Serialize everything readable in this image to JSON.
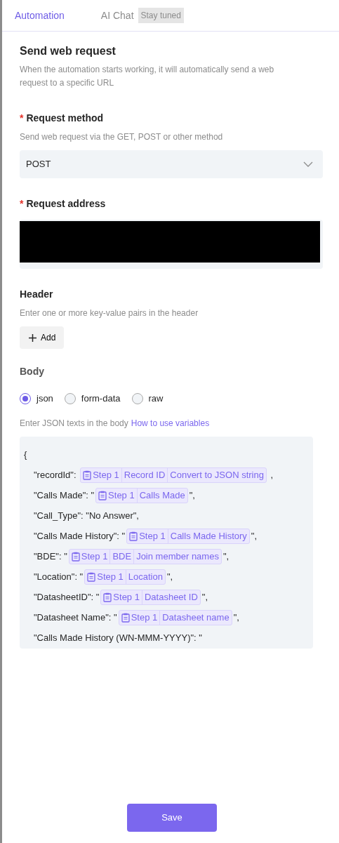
{
  "tabs": [
    {
      "label": "Automation",
      "selected": true
    },
    {
      "label": "AI Chat",
      "selected": false,
      "badge": "Stay tuned"
    }
  ],
  "title": "Send web request",
  "description": "When the automation starts working, it will automatically send a web request to a specific URL",
  "method": {
    "label": "Request method",
    "required_mark": "*",
    "hint": "Send web request via the GET, POST or other method",
    "value": "POST"
  },
  "address": {
    "label": "Request address",
    "required_mark": "*",
    "redacted": true
  },
  "header": {
    "label": "Header",
    "hint": "Enter one or more key-value pairs in the header",
    "add_button": "Add"
  },
  "body": {
    "label": "Body",
    "formats": [
      {
        "label": "json",
        "selected": true
      },
      {
        "label": "form-data",
        "selected": false
      },
      {
        "label": "raw",
        "selected": false
      }
    ],
    "hint": "Enter JSON texts in the body",
    "link": "How to use variables",
    "lines": [
      [
        {
          "kind": "text",
          "text": "{"
        }
      ],
      [
        {
          "kind": "text",
          "text": "\"recordId\": "
        },
        {
          "kind": "token",
          "segments": [
            "Step 1",
            "Record ID",
            "Convert to JSON string"
          ]
        },
        {
          "kind": "text",
          "text": " ,"
        }
      ],
      [
        {
          "kind": "text",
          "text": "\"Calls Made\": \""
        },
        {
          "kind": "token",
          "segments": [
            "Step 1",
            "Calls Made"
          ]
        },
        {
          "kind": "text",
          "text": "\","
        }
      ],
      [
        {
          "kind": "text",
          "text": "\"Call_Type\": \"No Answer\","
        }
      ],
      [
        {
          "kind": "text",
          "text": "\"Calls Made History\": \""
        },
        {
          "kind": "token",
          "segments": [
            "Step 1",
            "Calls Made History"
          ]
        },
        {
          "kind": "text",
          "text": "\","
        }
      ],
      [
        {
          "kind": "text",
          "text": "\"BDE\": \""
        },
        {
          "kind": "token",
          "segments": [
            "Step 1",
            "BDE",
            "Join member names"
          ]
        },
        {
          "kind": "text",
          "text": "\","
        }
      ],
      [
        {
          "kind": "text",
          "text": "\"Location\": \""
        },
        {
          "kind": "token",
          "segments": [
            "Step 1",
            "Location"
          ]
        },
        {
          "kind": "text",
          "text": "\","
        }
      ],
      [
        {
          "kind": "text",
          "text": "\"DatasheetID\": \""
        },
        {
          "kind": "token",
          "segments": [
            "Step 1",
            "Datasheet ID"
          ]
        },
        {
          "kind": "text",
          "text": "\","
        }
      ],
      [
        {
          "kind": "text",
          "text": "\"Datasheet Name\": \""
        },
        {
          "kind": "token",
          "segments": [
            "Step 1",
            "Datasheet name"
          ]
        },
        {
          "kind": "text",
          "text": "\","
        }
      ],
      [
        {
          "kind": "text",
          "text": "\"Calls Made History (WN-MMM-YYYY)\": \""
        }
      ]
    ]
  },
  "save_button": "Save"
}
